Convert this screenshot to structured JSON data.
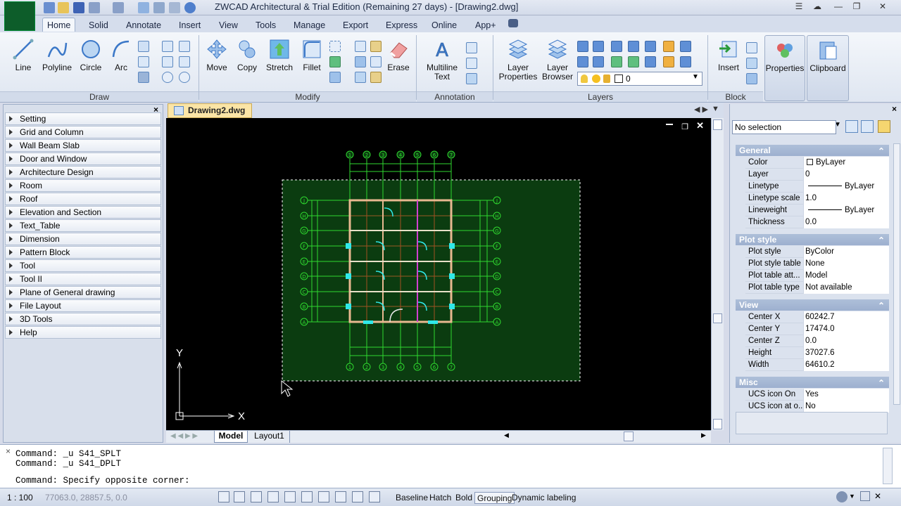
{
  "app": {
    "title": "ZWCAD Architectural & Trial Edition (Remaining 27 days)  - [Drawing2.dwg]",
    "logo": "A"
  },
  "tabs": [
    "Home",
    "Solid",
    "Annotate",
    "Insert",
    "View",
    "Tools",
    "Manage",
    "Export",
    "Express",
    "Online",
    "App+"
  ],
  "ribbon": {
    "draw": {
      "label": "Draw",
      "buttons": [
        "Line",
        "Polyline",
        "Circle",
        "Arc"
      ]
    },
    "modify": {
      "label": "Modify",
      "buttons": [
        "Move",
        "Copy",
        "Stretch",
        "Fillet",
        "Erase"
      ]
    },
    "annotation": {
      "label": "Annotation",
      "mtext": [
        "Multiline",
        "Text"
      ]
    },
    "layers": {
      "label": "Layers",
      "layer_props": [
        "Layer",
        "Properties"
      ],
      "layer_browser": [
        "Layer",
        "Browser"
      ],
      "current_layer": "0"
    },
    "block": {
      "label": "Block",
      "insert": "Insert"
    },
    "properties": "Properties",
    "clipboard": "Clipboard"
  },
  "left_panel": {
    "items": [
      "Setting",
      "Grid and Column",
      "Wall Beam Slab",
      "Door and Window",
      "Architecture Design",
      "Room",
      "Roof",
      "Elevation and Section",
      "Text_Table",
      "Dimension",
      "Pattern Block",
      "Tool",
      "Tool II",
      "Plane of General drawing",
      "File Layout",
      "3D Tools",
      "Help"
    ]
  },
  "document": {
    "tab": "Drawing2.dwg",
    "axis_x": "X",
    "axis_y": "Y",
    "layout_tabs": [
      "Model",
      "Layout1"
    ],
    "top_axes": [
      "1",
      "2",
      "3",
      "4",
      "5",
      "6",
      "7"
    ],
    "side_axes": [
      "J",
      "H",
      "G",
      "F",
      "E",
      "D",
      "C",
      "B",
      "A"
    ]
  },
  "properties": {
    "selection": "No selection",
    "sections": [
      {
        "title": "General",
        "rows": [
          [
            "Color",
            "ByLayer"
          ],
          [
            "Layer",
            "0"
          ],
          [
            "Linetype",
            "ByLayer"
          ],
          [
            "Linetype scale",
            "1.0"
          ],
          [
            "Lineweight",
            "ByLayer"
          ],
          [
            "Thickness",
            "0.0"
          ]
        ]
      },
      {
        "title": "Plot style",
        "rows": [
          [
            "Plot style",
            "ByColor"
          ],
          [
            "Plot style table",
            "None"
          ],
          [
            "Plot table att...",
            "Model"
          ],
          [
            "Plot table type",
            "Not available"
          ]
        ]
      },
      {
        "title": "View",
        "rows": [
          [
            "Center X",
            "60242.7"
          ],
          [
            "Center Y",
            "17474.0"
          ],
          [
            "Center Z",
            "0.0"
          ],
          [
            "Height",
            "37027.6"
          ],
          [
            "Width",
            "64610.2"
          ]
        ]
      },
      {
        "title": "Misc",
        "rows": [
          [
            "UCS icon On",
            "Yes"
          ],
          [
            "UCS icon at o...",
            "No"
          ]
        ]
      }
    ]
  },
  "command": {
    "lines": [
      "Command: _u S41_SPLT",
      "Command: _u S41_DPLT"
    ],
    "prompt": "Command: Specify opposite corner:"
  },
  "status": {
    "scale": "1 : 100",
    "coords": "77063.0, 28857.5, 0.0",
    "toggles": [
      "Baseline",
      "Hatch",
      "Bold",
      "Grouping",
      "Dynamic labeling"
    ]
  }
}
